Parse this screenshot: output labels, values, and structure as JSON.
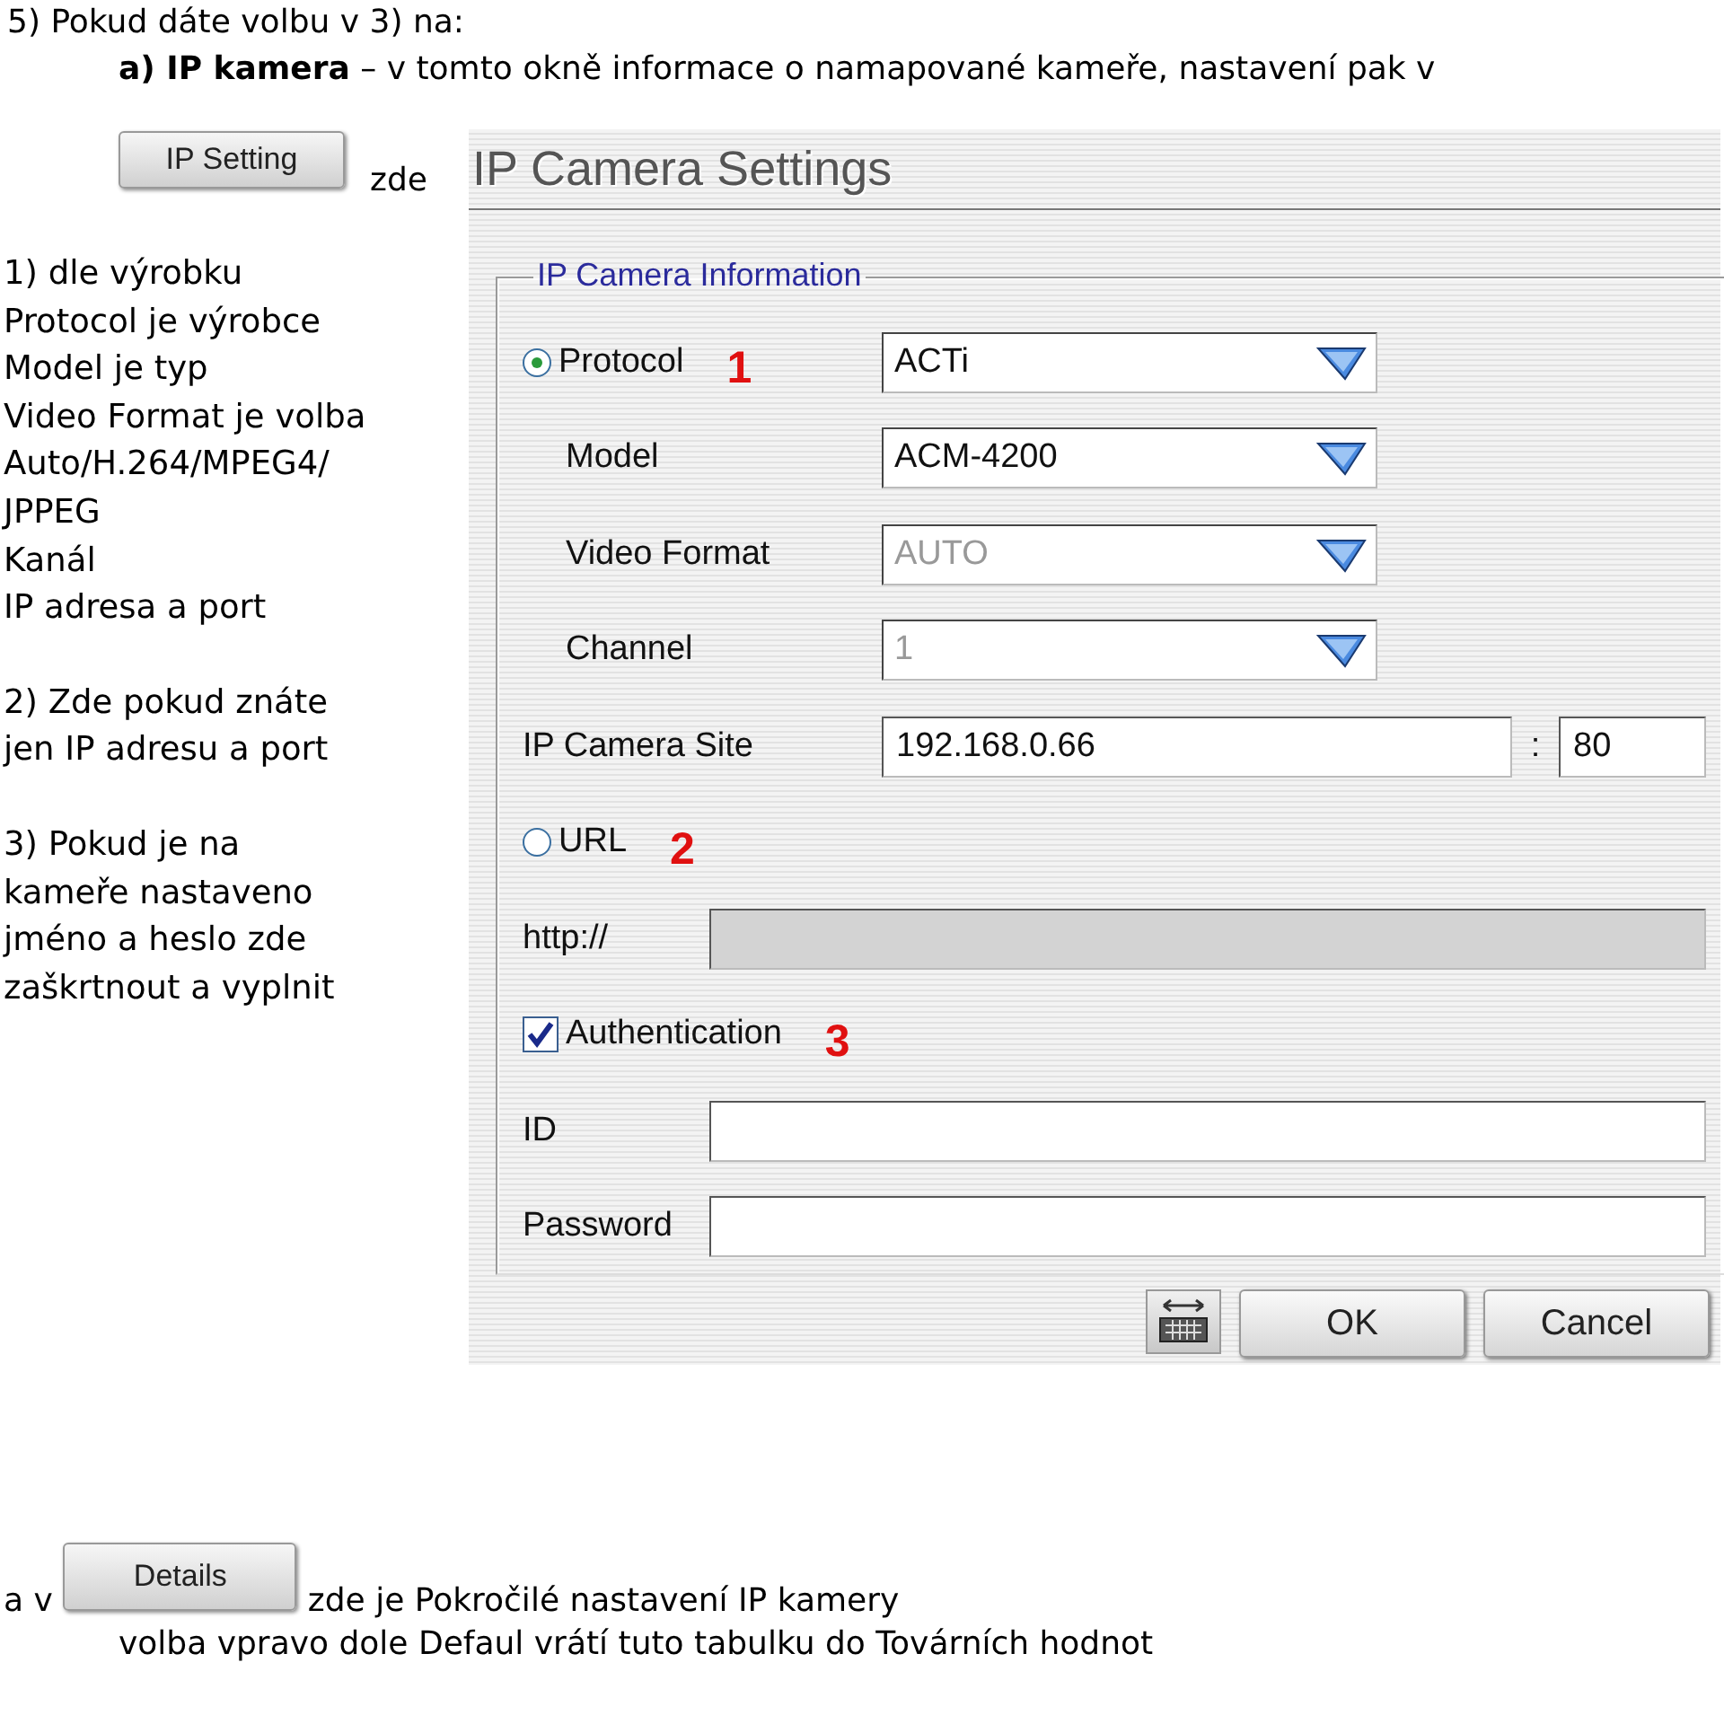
{
  "heading": "5) Pokud dáte volbu v 3) na:",
  "intro": "**a) IP kamera** – v tomto okně informace o namapované kameře, nastavení pak v",
  "ip_setting_button": "IP Setting",
  "ip_setting_suffix": "zde",
  "notes": [
    {
      "lines": [
        "1) dle výrobku",
        "Protocol je výrobce",
        "Model je typ",
        "Video Format je volba",
        "Auto/H.264/MPEG4/",
        "JPPEG",
        "Kanál",
        "IP adresa a port"
      ]
    },
    {
      "lines": [
        "2) Zde pokud znáte",
        "jen IP adresu a port"
      ]
    },
    {
      "lines": [
        "3) Pokud je na",
        "kameře nastaveno",
        "jméno a heslo zde",
        "zaškrtnout a vyplnit"
      ]
    }
  ],
  "dialog": {
    "title": "IP Camera Settings",
    "group": "IP Camera Information",
    "rows": [
      {
        "kind": "radio",
        "label": "Protocol",
        "selected": true,
        "marker": "1",
        "value": "ACTi",
        "disabled": false
      },
      {
        "kind": "select",
        "label": "Model",
        "value": "ACM-4200",
        "disabled": false
      },
      {
        "kind": "select",
        "label": "Video Format",
        "value": "AUTO",
        "disabled": true
      },
      {
        "kind": "select",
        "label": "Channel",
        "value": "1",
        "disabled": true
      },
      {
        "kind": "site",
        "label": "IP Camera Site",
        "value": "192.168.0.66",
        "separator": ":",
        "port": "80"
      },
      {
        "kind": "radio",
        "label": "URL",
        "selected": false,
        "marker": "2"
      },
      {
        "kind": "text",
        "label": "http://",
        "disabled": true
      },
      {
        "kind": "checkbox",
        "label": "Authentication",
        "checked": true,
        "marker": "3"
      },
      {
        "kind": "text",
        "label": "ID",
        "disabled": false
      },
      {
        "kind": "text",
        "label": "Password",
        "disabled": false
      }
    ],
    "buttons": [
      "OK",
      "Cancel"
    ]
  },
  "footer": {
    "prefix": "a v",
    "details_button": "Details",
    "suffix": "zde je Pokročilé nastavení IP kamery",
    "line2": "volba vpravo dole Defaul vrátí tuto tabulku do Továrních hodnot"
  }
}
